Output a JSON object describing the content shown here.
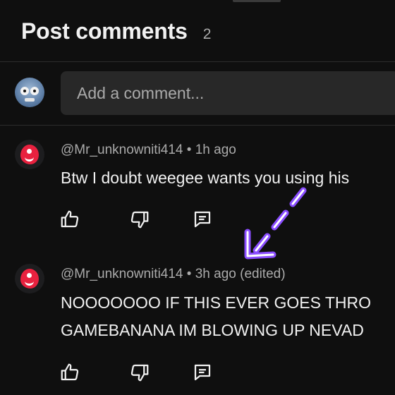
{
  "header": {
    "title": "Post comments",
    "count": "2"
  },
  "composer": {
    "placeholder": "Add a comment..."
  },
  "comments": [
    {
      "author": "@Mr_unknowniti414",
      "separator": "•",
      "time": "1h ago",
      "lines": [
        "Btw I doubt weegee wants you using his"
      ],
      "actions": {
        "like": "thumbs-up-icon",
        "dislike": "thumbs-down-icon",
        "reply": "reply-icon"
      }
    },
    {
      "author": "@Mr_unknowniti414",
      "separator": "•",
      "time": "3h ago (edited)",
      "lines": [
        "NOOOOOOO IF THIS EVER GOES THRO",
        "GAMEBANANA IM BLOWING UP NEVAD"
      ],
      "actions": {
        "like": "thumbs-up-icon",
        "dislike": "thumbs-down-icon",
        "reply": "reply-icon"
      }
    }
  ],
  "annotation": {
    "arrow_color": "#8a4dff",
    "arrow_icon": "dashed-arrow-icon"
  },
  "colors": {
    "background": "#0f0f0f",
    "input_background": "#282828",
    "primary_text": "#f1f1f1",
    "secondary_text": "#aaaaaa",
    "avatar_accent": "#e8213f"
  }
}
